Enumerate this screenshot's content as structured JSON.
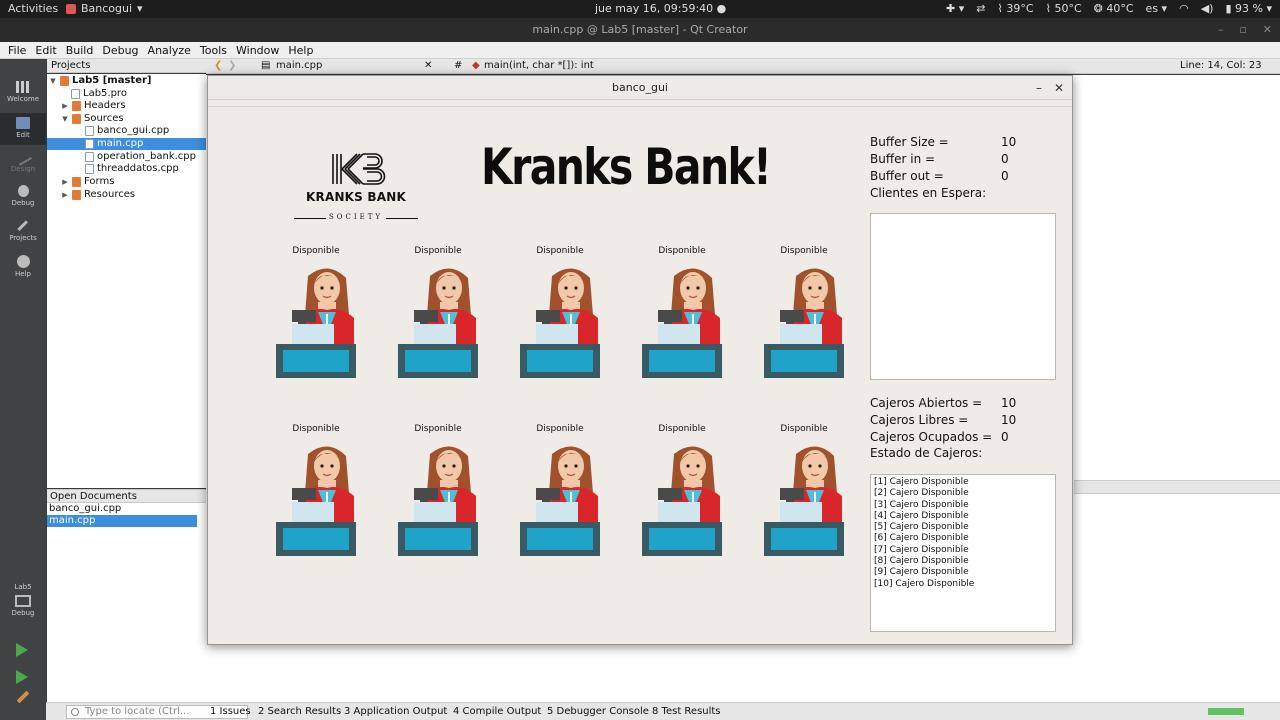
{
  "topbar": {
    "activities": "Activities",
    "app_name": "Bancogui",
    "clock": "jue may 16, 09:59:40",
    "temp1": "39°C",
    "temp2": "50°C",
    "temp3": "40°C",
    "lang": "es",
    "battery": "93 %"
  },
  "qt": {
    "window_title": "main.cpp @ Lab5 [master] - Qt Creator",
    "menu": [
      "File",
      "Edit",
      "Build",
      "Debug",
      "Analyze",
      "Tools",
      "Window",
      "Help"
    ],
    "modes": [
      "Welcome",
      "Edit",
      "Design",
      "Debug",
      "Projects",
      "Help"
    ],
    "kit_project": "Lab5",
    "kit_mode": "Debug",
    "projects_label": "Projects",
    "tree": [
      {
        "label": "Lab5 [master]",
        "kind": "proj"
      },
      {
        "label": "Lab5.pro",
        "kind": "file"
      },
      {
        "label": "Headers",
        "kind": "folder"
      },
      {
        "label": "Sources",
        "kind": "folder"
      },
      {
        "label": "banco_gui.cpp",
        "kind": "file"
      },
      {
        "label": "main.cpp",
        "kind": "file"
      },
      {
        "label": "operation_bank.cpp",
        "kind": "file"
      },
      {
        "label": "threaddatos.cpp",
        "kind": "file"
      },
      {
        "label": "Forms",
        "kind": "folder"
      },
      {
        "label": "Resources",
        "kind": "folder"
      }
    ],
    "open_documents_label": "Open Documents",
    "open_documents": [
      "banco_gui.cpp",
      "main.cpp"
    ],
    "editor_file": "main.cpp",
    "editor_symbol": "main(int, char *[]): int",
    "hash": "#",
    "line_col": "Line: 14, Col: 23",
    "locator_placeholder": "Type to locate (Ctrl...",
    "output_tabs": [
      "1  Issues",
      "2  Search Results",
      "3  Application Output",
      "4  Compile Output",
      "5  Debugger Console",
      "8  Test Results"
    ]
  },
  "banco": {
    "title": "banco_gui",
    "bank_title": "Kranks Bank!",
    "logo_monogram": "KB",
    "logo_name": "KRANKS BANK",
    "logo_society": "SOCIETY",
    "cashier_status": [
      "Disponible",
      "Disponible",
      "Disponible",
      "Disponible",
      "Disponible",
      "Disponible",
      "Disponible",
      "Disponible",
      "Disponible",
      "Disponible"
    ],
    "buffer_size_label": "Buffer Size =",
    "buffer_size": "10",
    "buffer_in_label": "Buffer in =",
    "buffer_in": "0",
    "buffer_out_label": "Buffer out =",
    "buffer_out": "0",
    "clientes_label": "Clientes en Espera:",
    "cajeros_abiertos_label": "Cajeros Abiertos =",
    "cajeros_abiertos": "10",
    "cajeros_libres_label": "Cajeros Libres =",
    "cajeros_libres": "10",
    "cajeros_ocupados_label": "Cajeros Ocupados =",
    "cajeros_ocupados": "0",
    "estado_label": "Estado de Cajeros:",
    "estado": [
      "[1] Cajero Disponible",
      "[2] Cajero Disponible",
      "[3] Cajero Disponible",
      "[4] Cajero Disponible",
      "[5] Cajero Disponible",
      "[6] Cajero Disponible",
      "[7] Cajero Disponible",
      "[8] Cajero Disponible",
      "[9] Cajero Disponible",
      "[10] Cajero Disponible"
    ]
  },
  "colors": {
    "desk": "#3a5a63",
    "desk_screen": "#1fa3c8",
    "jacket": "#d9262b",
    "hair": "#a0522d",
    "selection": "#3d8ee0"
  }
}
